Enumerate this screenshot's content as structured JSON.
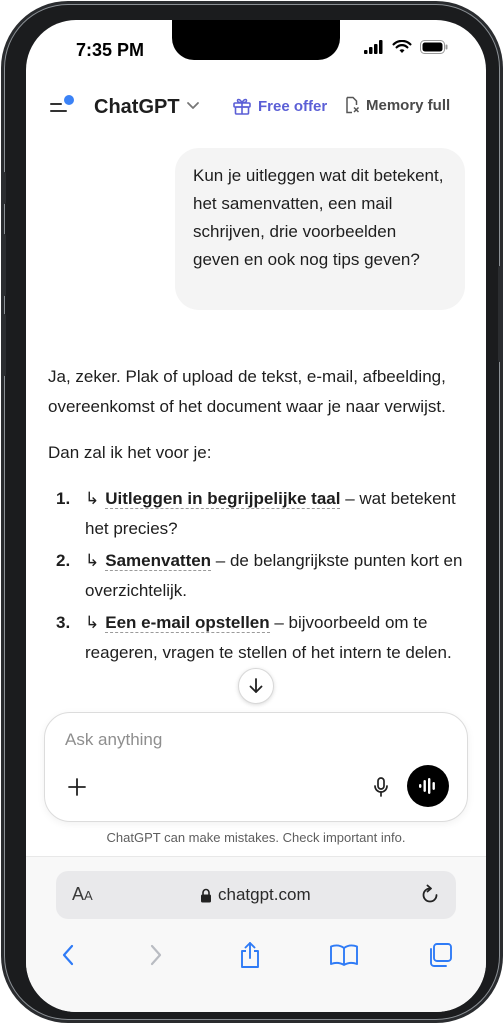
{
  "status": {
    "time": "7:35 PM"
  },
  "header": {
    "app_title": "ChatGPT",
    "free_offer_label": "Free offer",
    "memory_label": "Memory full"
  },
  "conversation": {
    "user_message": "Kun je uitleggen wat dit betekent, het samenvatten, een mail schrijven, drie voorbeelden geven en ook nog tips geven?",
    "assistant_intro": "Ja, zeker. Plak of upload de tekst, e-mail, afbeelding, overeenkomst of het document waar je naar verwijst.",
    "assistant_lead": "Dan zal ik het voor je:",
    "list": [
      {
        "num": "1.",
        "arrow": "↳",
        "bold": "Uitleggen in begrijpelijke taal",
        "rest": " – wat betekent het precies?"
      },
      {
        "num": "2.",
        "arrow": "↳",
        "bold": "Samenvatten",
        "rest": " – de belangrijkste punten kort en overzichtelijk."
      },
      {
        "num": "3.",
        "arrow": "↳",
        "bold": "Een e-mail opstellen",
        "rest": " – bijvoorbeeld om te reageren, vragen te stellen of het intern te delen."
      }
    ]
  },
  "composer": {
    "placeholder": "Ask anything"
  },
  "disclaimer": "ChatGPT can make mistakes. Check important info.",
  "browser": {
    "aa_large": "A",
    "aa_small": "A",
    "url": "chatgpt.com"
  },
  "icons": {
    "menu": "menu-icon",
    "chevron": "chevron-down-icon",
    "gift": "gift-icon",
    "memory": "memory-icon",
    "scroll": "arrow-down-icon",
    "plus": "plus-icon",
    "mic": "microphone-icon",
    "voice": "voice-mode-icon",
    "lock": "lock-icon",
    "reload": "reload-icon",
    "back": "back-icon",
    "forward": "forward-icon",
    "share": "share-icon",
    "bookmarks": "bookmarks-icon",
    "tabs": "tabs-icon"
  },
  "colors": {
    "accent": "#5b5fd6",
    "notification_dot": "#3b82f6",
    "voice_button": "#000000"
  }
}
